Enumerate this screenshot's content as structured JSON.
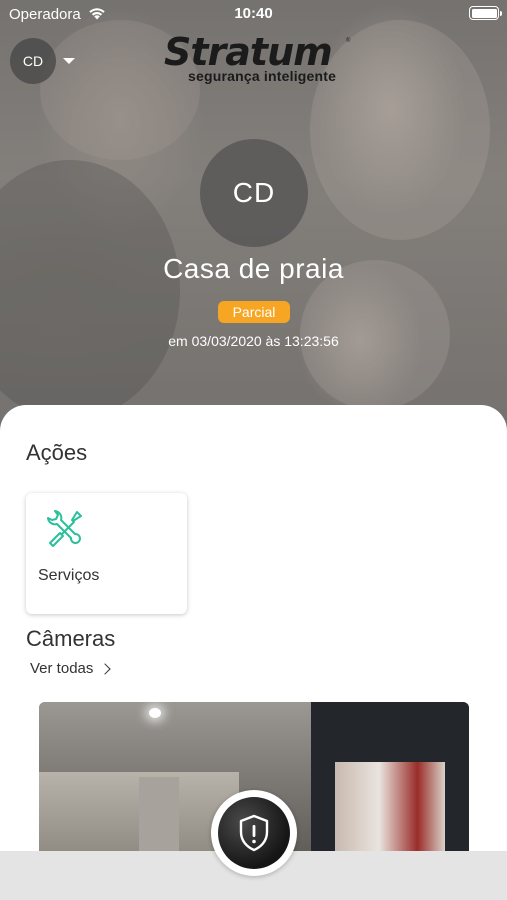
{
  "status_bar": {
    "carrier": "Operadora",
    "time": "10:40",
    "wifi_icon": "wifi-icon",
    "battery_icon": "battery-icon"
  },
  "header": {
    "profile_initials": "CD",
    "logo_word": "Stratum",
    "logo_tagline": "segurança inteligente",
    "logo_mark": "®"
  },
  "site": {
    "initials": "CD",
    "name": "Casa de praia",
    "status": "Parcial",
    "status_color": "#f6a623",
    "status_time": "em 03/03/2020 às 13:23:56"
  },
  "actions": {
    "title": "Ações",
    "items": [
      {
        "label": "Serviços",
        "icon": "tools-icon",
        "icon_color": "#2bbf9c"
      }
    ]
  },
  "cameras": {
    "title": "Câmeras",
    "see_all": "Ver todas"
  },
  "panic": {
    "icon": "shield-alert-icon"
  }
}
